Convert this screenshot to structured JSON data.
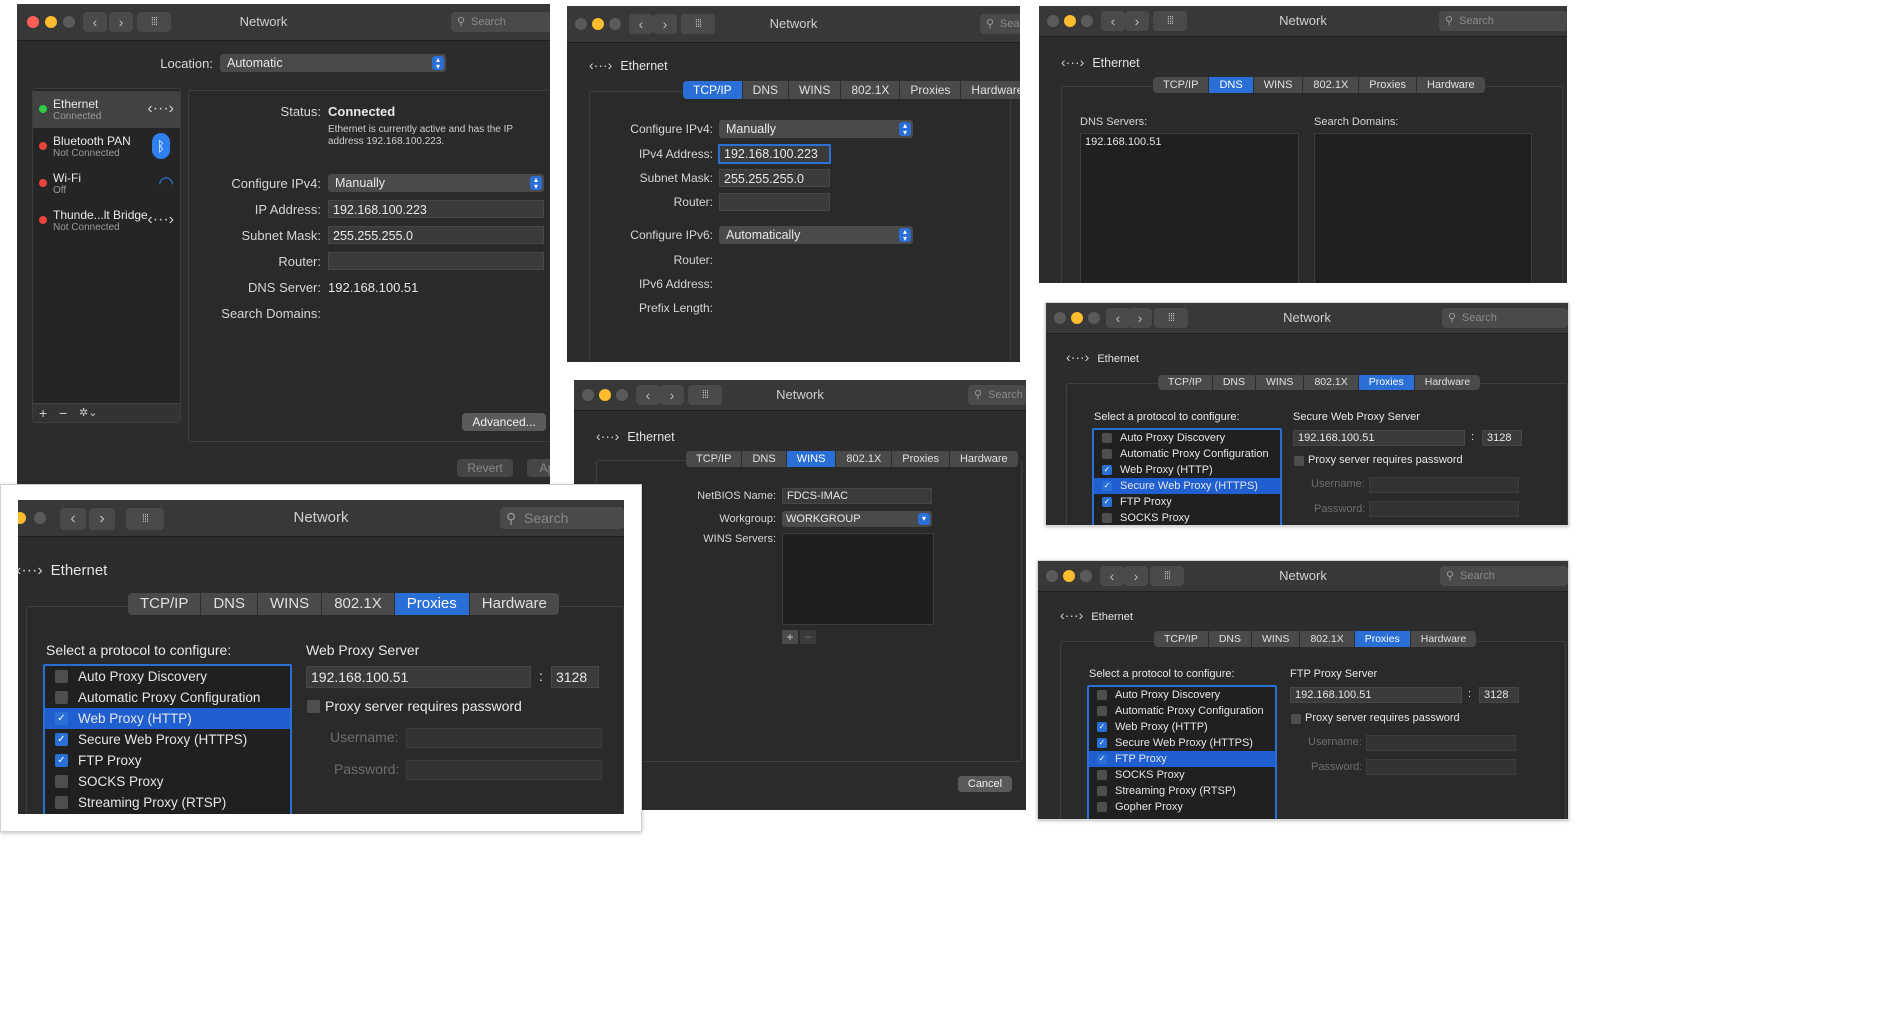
{
  "window_title": "Network",
  "search_placeholder": "Search",
  "p1": {
    "location_label": "Location:",
    "location_value": "Automatic",
    "services": [
      {
        "name": "Ethernet",
        "status": "Connected"
      },
      {
        "name": "Bluetooth PAN",
        "status": "Not Connected"
      },
      {
        "name": "Wi-Fi",
        "status": "Off"
      },
      {
        "name": "Thunde...lt Bridge",
        "status": "Not Connected"
      }
    ],
    "status_label": "Status:",
    "status_value": "Connected",
    "status_desc_1": "Ethernet is currently active and has the IP",
    "status_desc_2": "address 192.168.100.223.",
    "configure_label": "Configure IPv4:",
    "configure_value": "Manually",
    "ip_label": "IP Address:",
    "ip_value": "192.168.100.223",
    "subnet_label": "Subnet Mask:",
    "subnet_value": "255.255.255.0",
    "router_label": "Router:",
    "dns_label": "DNS Server:",
    "dns_value": "192.168.100.51",
    "search_domains_label": "Search Domains:",
    "advanced_label": "Advanced...",
    "revert_label": "Revert",
    "apply_label": "Ap",
    "add": "+",
    "remove": "−",
    "gear": "✲⌄"
  },
  "ethernet_label": "Ethernet",
  "tabs": [
    "TCP/IP",
    "DNS",
    "WINS",
    "802.1X",
    "Proxies",
    "Hardware"
  ],
  "p2": {
    "configure4_label": "Configure IPv4:",
    "configure4_value": "Manually",
    "ipv4_label": "IPv4 Address:",
    "ipv4_value": "192.168.100.223",
    "subnet_label": "Subnet Mask:",
    "subnet_value": "255.255.255.0",
    "router_label": "Router:",
    "configure6_label": "Configure IPv6:",
    "configure6_value": "Automatically",
    "router6_label": "Router:",
    "ipv6_label": "IPv6 Address:",
    "prefix_label": "Prefix Length:"
  },
  "p3": {
    "dns_servers_label": "DNS Servers:",
    "dns_server_entry": "192.168.100.51",
    "search_domains_label": "Search Domains:"
  },
  "p4": {
    "netbios_label": "NetBIOS Name:",
    "netbios_value": "FDCS-IMAC",
    "workgroup_label": "Workgroup:",
    "workgroup_value": "WORKGROUP",
    "wins_servers_label": "WINS Servers:",
    "cancel_label": "Cancel"
  },
  "proxy": {
    "select_label": "Select a protocol to configure:",
    "protocols": [
      "Auto Proxy Discovery",
      "Automatic Proxy Configuration",
      "Web Proxy (HTTP)",
      "Secure Web Proxy (HTTPS)",
      "FTP Proxy",
      "SOCKS Proxy",
      "Streaming Proxy (RTSP)",
      "Gopher Proxy"
    ],
    "server_ip": "192.168.100.51",
    "port": "3128",
    "colon": ":",
    "requires_password": "Proxy server requires password",
    "username_label": "Username:",
    "password_label": "Password:"
  },
  "p5": {
    "server_title": "Secure Web Proxy Server"
  },
  "p6": {
    "server_title": "Web Proxy Server"
  },
  "p7": {
    "server_title": "FTP Proxy Server"
  },
  "colors": {
    "accent": "#2a6fd6",
    "window_bg": "#2c2c2e",
    "titlebar": "#383838"
  }
}
